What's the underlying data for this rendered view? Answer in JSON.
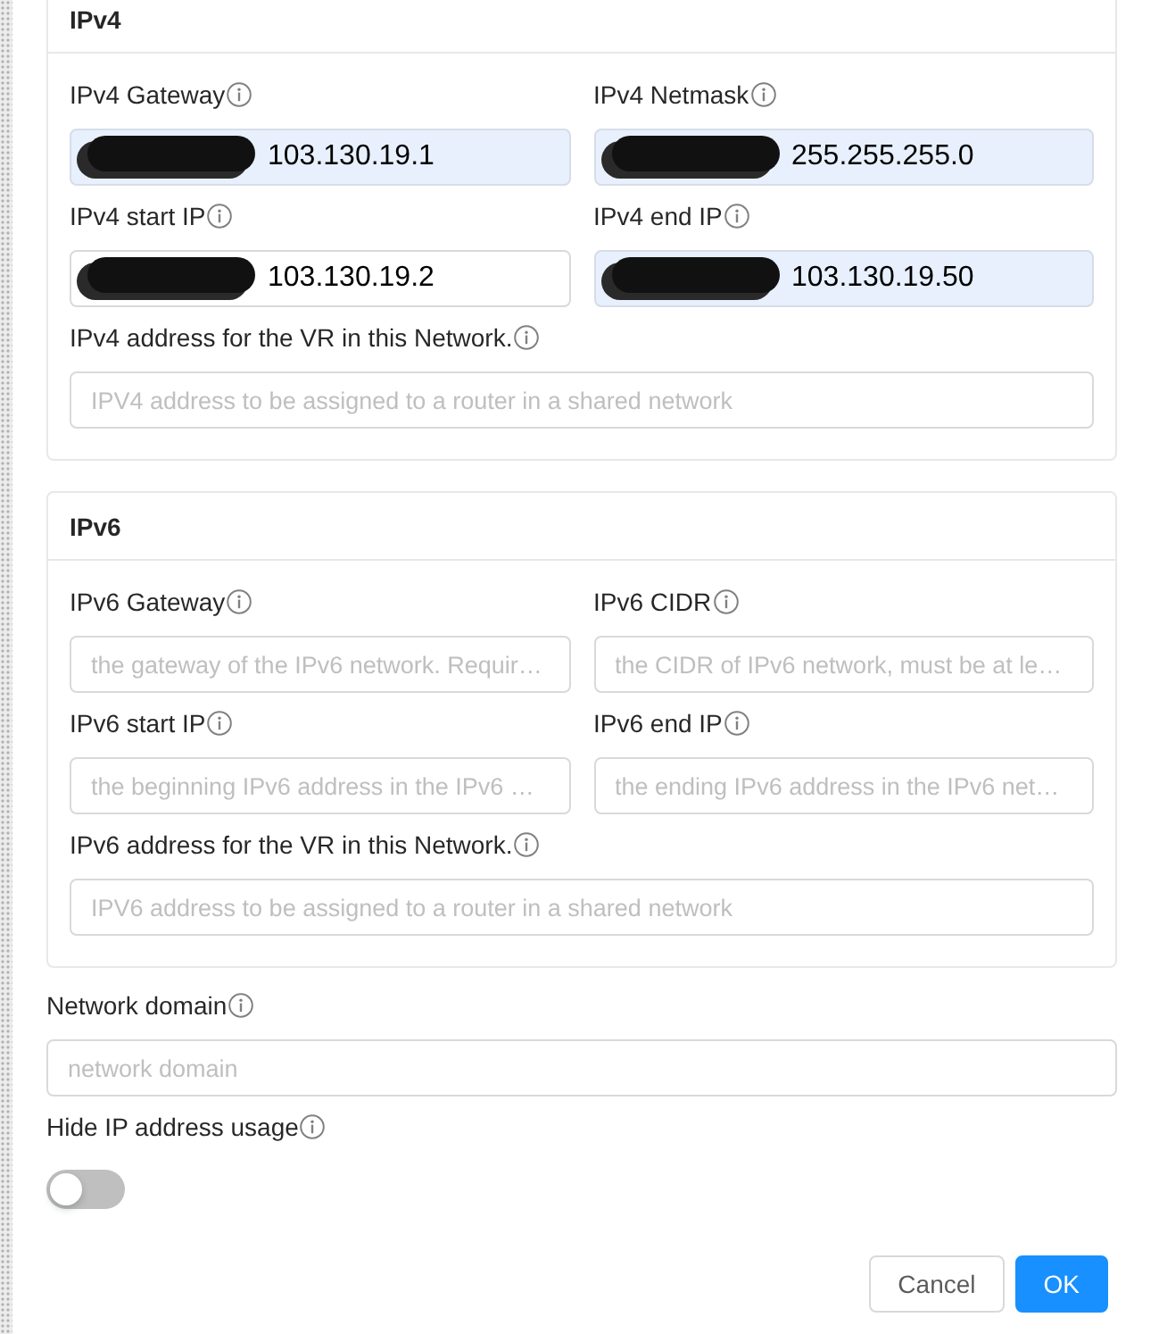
{
  "sections": [
    {
      "title": "IPv4",
      "rows": [
        [
          {
            "label": "IPv4 Gateway",
            "value": "103.130.19.1",
            "autofilled": true,
            "redacted": true
          },
          {
            "label": "IPv4 Netmask",
            "value": "255.255.255.0",
            "autofilled": true,
            "redacted": true
          }
        ],
        [
          {
            "label": "IPv4 start IP",
            "value": "103.130.19.2",
            "autofilled": false,
            "redacted": true
          },
          {
            "label": "IPv4 end IP",
            "value": "103.130.19.50",
            "autofilled": true,
            "redacted": true
          }
        ],
        [
          {
            "label": "IPv4 address for the VR in this Network.",
            "placeholder": "IPV4 address to be assigned to a router in a shared network",
            "autofilled": false,
            "redacted": false
          }
        ]
      ]
    },
    {
      "title": "IPv6",
      "rows": [
        [
          {
            "label": "IPv6 Gateway",
            "placeholder": "the gateway of the IPv6 network. Requir…"
          },
          {
            "label": "IPv6 CIDR",
            "placeholder": "the CIDR of IPv6 network, must be at le…"
          }
        ],
        [
          {
            "label": "IPv6 start IP",
            "placeholder": "the beginning IPv6 address in the IPv6 …"
          },
          {
            "label": "IPv6 end IP",
            "placeholder": "the ending IPv6 address in the IPv6 net…"
          }
        ],
        [
          {
            "label": "IPv6 address for the VR in this Network.",
            "placeholder": "IPV6 address to be assigned to a router in a shared network"
          }
        ]
      ]
    }
  ],
  "network_domain": {
    "label": "Network domain",
    "placeholder": "network domain"
  },
  "hide_ip_usage": {
    "label": "Hide IP address usage",
    "on": false
  },
  "buttons": [
    {
      "label": "Cancel",
      "kind": "default"
    },
    {
      "label": "OK",
      "kind": "primary"
    }
  ]
}
